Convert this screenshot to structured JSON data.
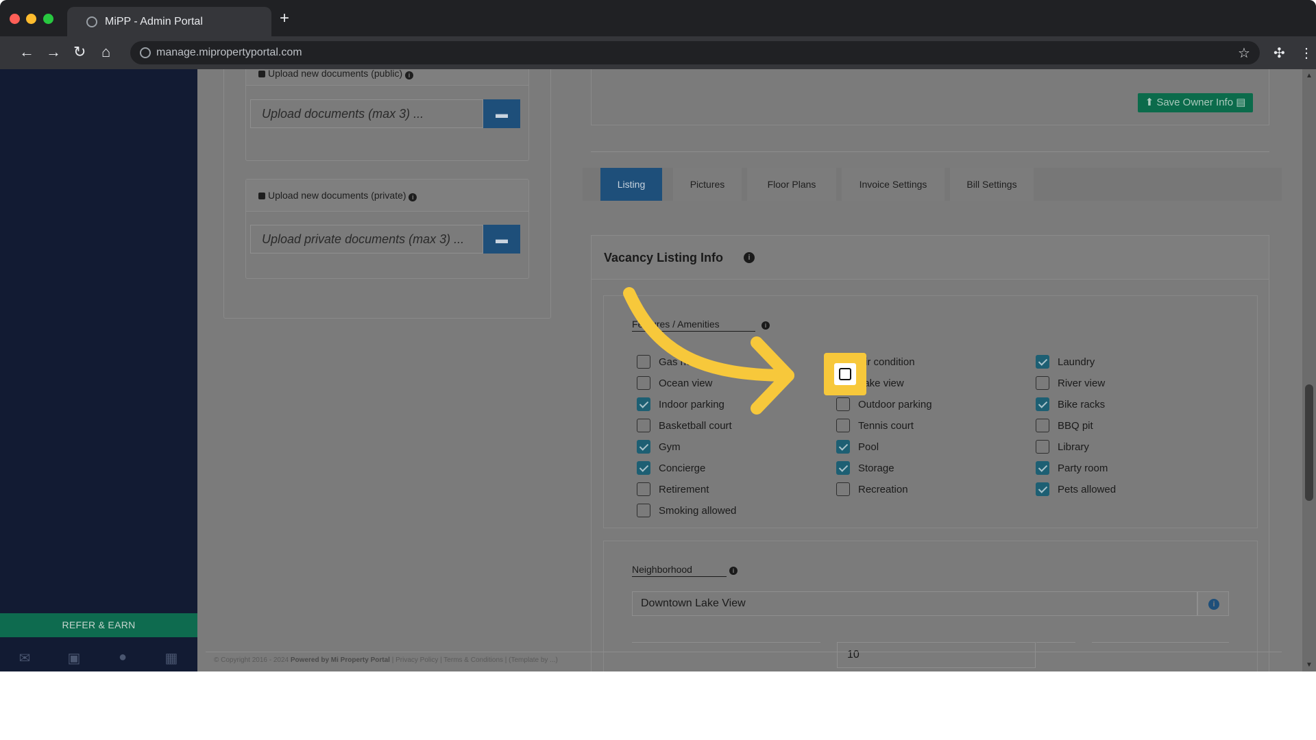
{
  "browser": {
    "tab_title": "MiPP - Admin Portal",
    "url": "manage.mipropertyportal.com"
  },
  "sidebar": {
    "refer_label": "REFER & EARN",
    "icons": [
      "envelope-icon",
      "briefcase-icon",
      "user-icon",
      "calculator-icon"
    ]
  },
  "documents": {
    "public_header": "Upload new documents (public)",
    "public_placeholder": "Upload documents (max 3) ...",
    "private_header": "Upload new documents (private)",
    "private_placeholder": "Upload private documents (max 3) ..."
  },
  "owner": {
    "save_label": "Save Owner Info"
  },
  "tabs": [
    {
      "label": "Listing",
      "active": true
    },
    {
      "label": "Pictures",
      "active": false
    },
    {
      "label": "Floor Plans",
      "active": false
    },
    {
      "label": "Invoice Settings",
      "active": false
    },
    {
      "label": "Bill Settings",
      "active": false
    }
  ],
  "vacancy": {
    "title": "Vacancy Listing Info",
    "features_label": "Features / Amenities",
    "amenities": [
      {
        "label": "Gas heat",
        "checked": false
      },
      {
        "label": "Air condition",
        "checked": true
      },
      {
        "label": "Laundry",
        "checked": true
      },
      {
        "label": "Ocean view",
        "checked": false
      },
      {
        "label": "Lake view",
        "checked": false
      },
      {
        "label": "River view",
        "checked": false
      },
      {
        "label": "Indoor parking",
        "checked": true
      },
      {
        "label": "Outdoor parking",
        "checked": false
      },
      {
        "label": "Bike racks",
        "checked": true
      },
      {
        "label": "Basketball court",
        "checked": false
      },
      {
        "label": "Tennis court",
        "checked": false
      },
      {
        "label": "BBQ pit",
        "checked": false
      },
      {
        "label": "Gym",
        "checked": true
      },
      {
        "label": "Pool",
        "checked": true
      },
      {
        "label": "Library",
        "checked": false
      },
      {
        "label": "Concierge",
        "checked": true
      },
      {
        "label": "Storage",
        "checked": true
      },
      {
        "label": "Party room",
        "checked": true
      },
      {
        "label": "Retirement",
        "checked": false
      },
      {
        "label": "Recreation",
        "checked": false
      },
      {
        "label": "Pets allowed",
        "checked": true
      },
      {
        "label": "Smoking allowed",
        "checked": false
      }
    ],
    "neighborhood_label": "Neighborhood",
    "neighborhood_value": "Downtown Lake View",
    "number_value": "10"
  },
  "footer": {
    "copyright": "© Copyright 2016 - 2024",
    "powered": "Powered by Mi Property Portal",
    "links": "| Privacy Policy | Terms & Conditions | (Template by ...)"
  },
  "colors": {
    "accent": "#1e4f7a",
    "checked": "#1d5f73",
    "highlight": "#f7c83b",
    "sidebar": "#121b33"
  }
}
